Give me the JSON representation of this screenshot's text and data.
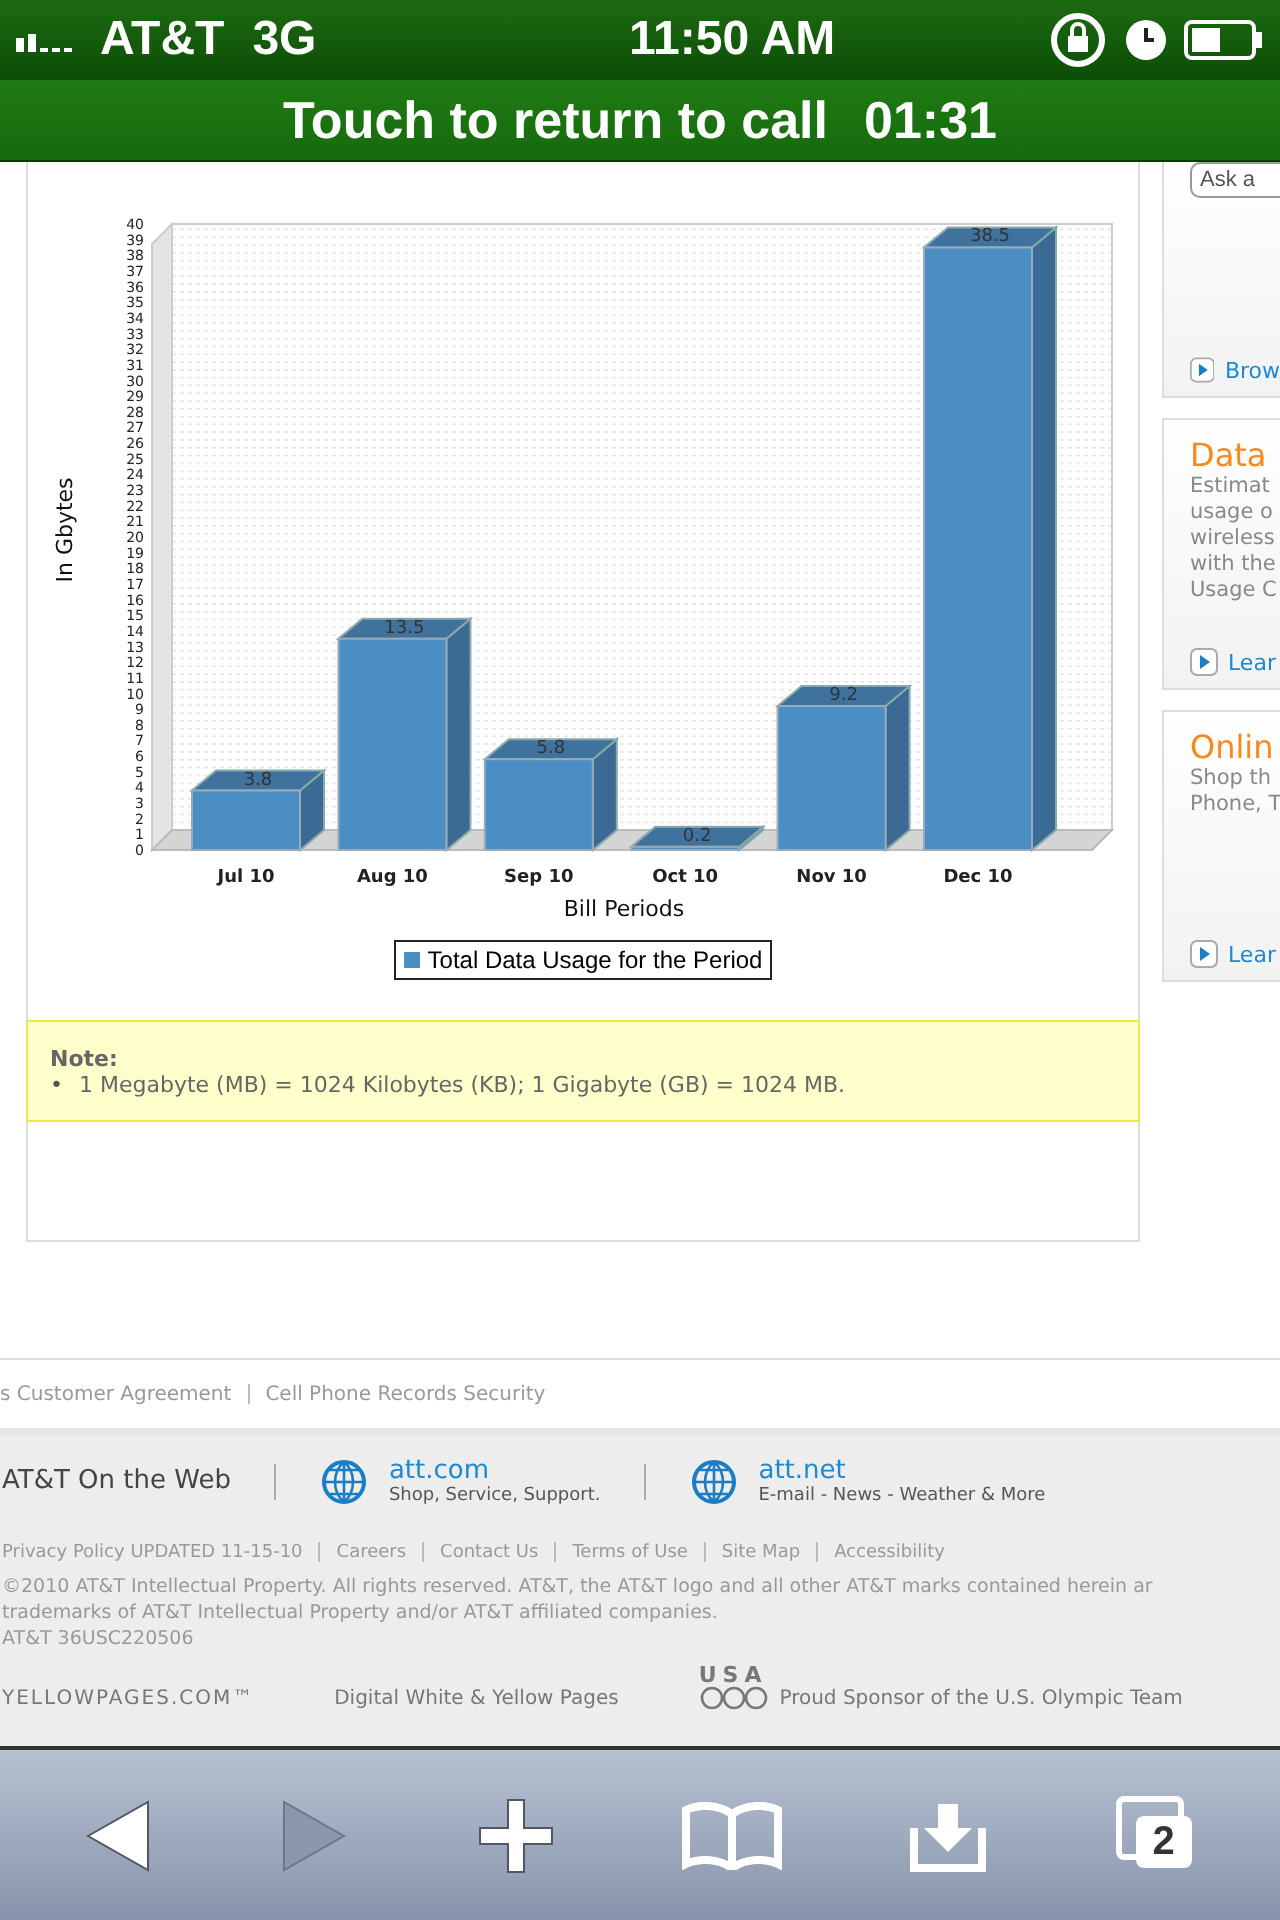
{
  "status_bar": {
    "carrier": "AT&T",
    "network": "3G",
    "time": "11:50 AM"
  },
  "call_bar": {
    "label": "Touch to return to call",
    "duration": "01:31"
  },
  "usage_chart": {
    "chart_data": {
      "type": "bar",
      "xlabel": "Bill Periods",
      "ylabel": "In Gbytes",
      "categories": [
        "Jul 10",
        "Aug 10",
        "Sep 10",
        "Oct 10",
        "Nov 10",
        "Dec 10"
      ],
      "series": [
        {
          "name": "Total Data Usage for the Period",
          "color": "#4a8ec4",
          "values": [
            3.8,
            13.5,
            5.8,
            0.2,
            9.2,
            38.5
          ]
        }
      ],
      "ylim": [
        0,
        40
      ],
      "yticks": [
        0,
        1,
        2,
        3,
        4,
        5,
        6,
        7,
        8,
        9,
        10,
        11,
        12,
        13,
        14,
        15,
        16,
        17,
        18,
        19,
        20,
        21,
        22,
        23,
        24,
        25,
        26,
        27,
        28,
        29,
        30,
        31,
        32,
        33,
        34,
        35,
        36,
        37,
        38,
        39,
        40
      ],
      "data_labels": true
    }
  },
  "note": {
    "title": "Note:",
    "bullet": "•",
    "items": [
      "1 Megabyte (MB) = 1024 Kilobytes (KB); 1 Gigabyte (GB) = 1024 MB."
    ]
  },
  "side_cards": [
    {
      "kind": "search",
      "placeholder": "Ask a",
      "link": "Brow"
    },
    {
      "kind": "promo",
      "title": "Data",
      "lines": [
        "Estimat",
        "usage o",
        "wireless",
        "with the",
        "Usage C"
      ],
      "link": "Lear"
    },
    {
      "kind": "promo",
      "title": "Onlin",
      "lines": [
        "Shop th",
        "Phone, T"
      ],
      "link": "Lear"
    }
  ],
  "footer": {
    "top_links": [
      "s Customer Agreement",
      "Cell Phone Records Security"
    ],
    "web_label": "AT&T On the Web",
    "web_sites": [
      {
        "name": "att.com",
        "tagline": "Shop, Service, Support."
      },
      {
        "name": "att.net",
        "tagline": "E-mail - News - Weather & More"
      }
    ],
    "links": [
      "Privacy Policy UPDATED 11-15-10",
      "Careers",
      "Contact Us",
      "Terms of Use",
      "Site Map",
      "Accessibility"
    ],
    "copyright": [
      "©2010 AT&T Intellectual Property. All rights reserved. AT&T, the AT&T logo and all other AT&T marks contained herein ar",
      "trademarks of AT&T Intellectual Property and/or AT&T affiliated companies.",
      "AT&T 36USC220506"
    ],
    "yellowpages": "YELLOWPAGES.COM™",
    "directory": "Digital White & Yellow Pages",
    "usa": "USA",
    "sponsor": "Proud Sponsor of the U.S. Olympic Team"
  },
  "toolbar": {
    "tab_count": "2",
    "forward_disabled": true
  }
}
